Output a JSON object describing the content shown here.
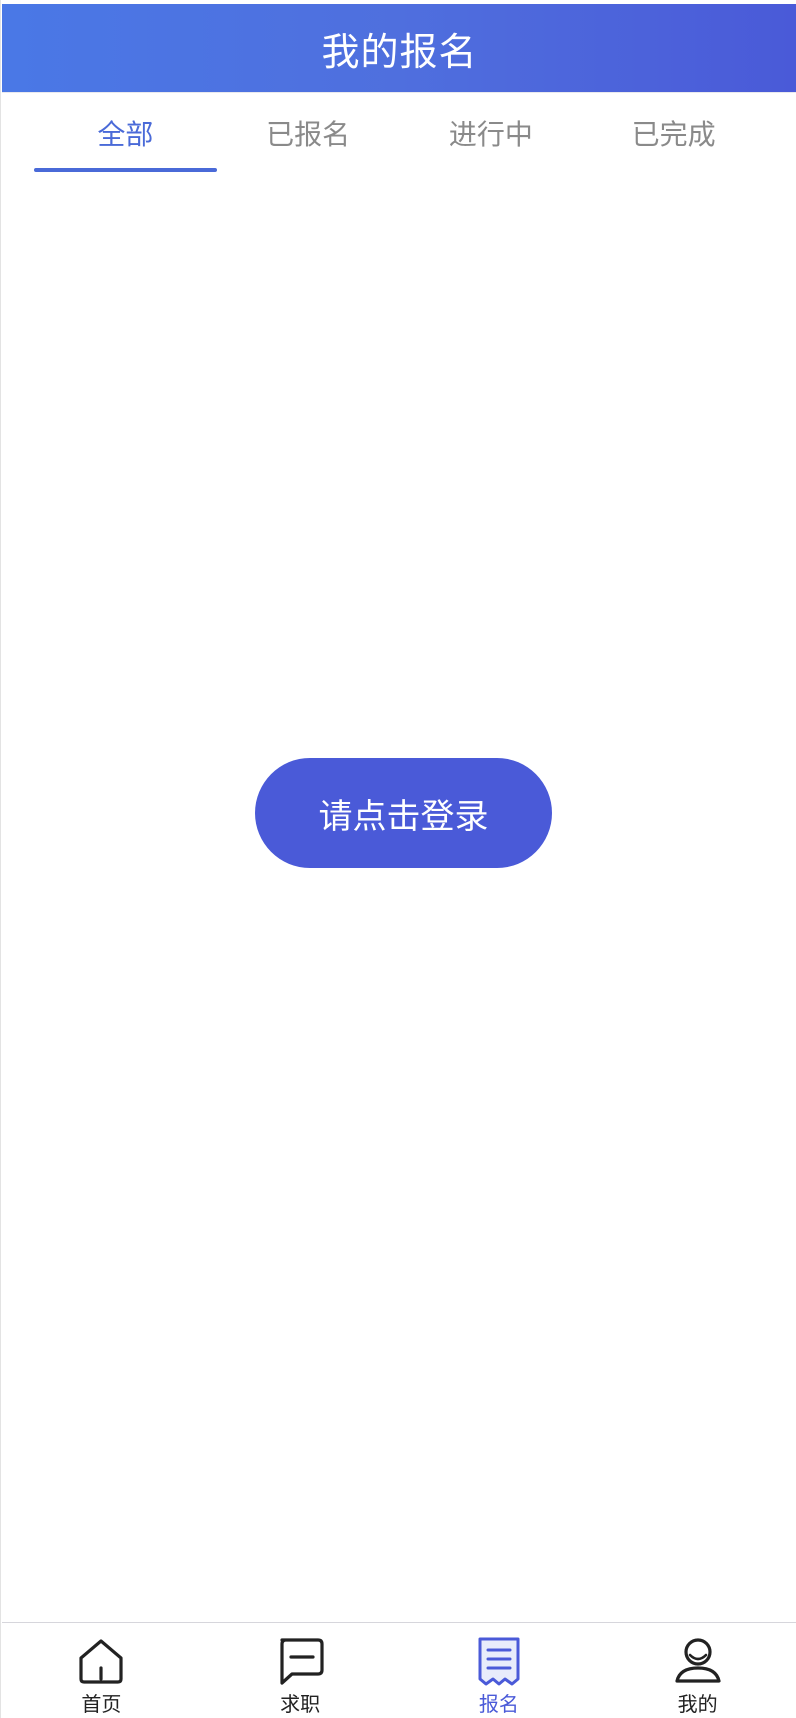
{
  "header": {
    "title": "我的报名"
  },
  "tabs": [
    {
      "label": "全部",
      "active": true
    },
    {
      "label": "已报名",
      "active": false
    },
    {
      "label": "进行中",
      "active": false
    },
    {
      "label": "已完成",
      "active": false
    }
  ],
  "main": {
    "login_button_label": "请点击登录"
  },
  "tabbar": [
    {
      "label": "首页",
      "icon": "home-icon",
      "active": false
    },
    {
      "label": "求职",
      "icon": "message-icon",
      "active": false
    },
    {
      "label": "报名",
      "icon": "list-icon",
      "active": true
    },
    {
      "label": "我的",
      "icon": "user-icon",
      "active": false
    }
  ],
  "colors": {
    "accent": "#4a5ad8",
    "tab_active": "#4a6ad8",
    "tab_inactive": "#8a8a8a",
    "header_gradient_start": "#4a78e6",
    "header_gradient_end": "#4a5ad8"
  }
}
